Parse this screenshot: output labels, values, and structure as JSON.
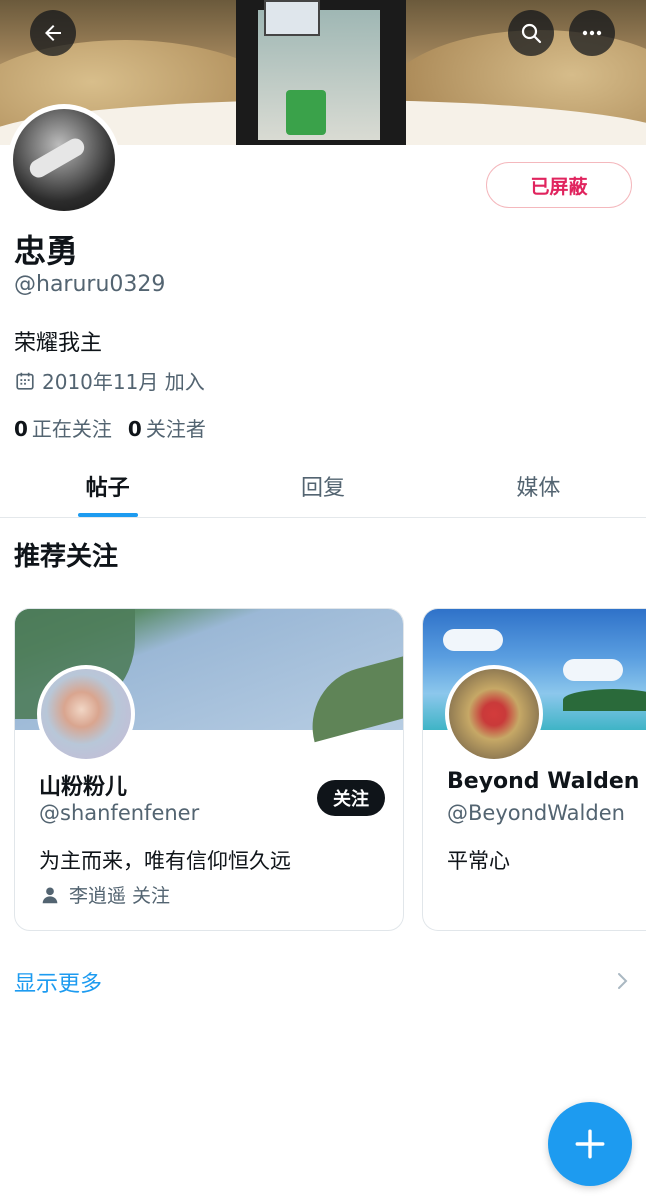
{
  "header": {
    "back_icon": "arrow-left-icon",
    "search_icon": "search-icon",
    "more_icon": "more-horizontal-icon"
  },
  "profile": {
    "display_name": "忠勇",
    "handle": "@haruru0329",
    "bio": "荣耀我主",
    "joined": "2010年11月 加入",
    "following_count": "0",
    "following_label": "正在关注",
    "followers_count": "0",
    "followers_label": "关注者",
    "blocked_label": "已屏蔽"
  },
  "tabs": [
    {
      "label": "帖子",
      "active": true
    },
    {
      "label": "回复",
      "active": false
    },
    {
      "label": "媒体",
      "active": false
    }
  ],
  "recommend": {
    "title": "推荐关注",
    "cards": [
      {
        "name": "山粉粉儿",
        "handle": "@shanfenfener",
        "bio": "为主而来，唯有信仰恒久远",
        "followed_by": "李逍遥 关注",
        "follow_label": "关注"
      },
      {
        "name": "Beyond Walden",
        "handle": "@BeyondWalden",
        "bio": "平常心"
      }
    ],
    "show_more": "显示更多"
  },
  "colors": {
    "accent": "#1d9bf0",
    "blocked_red": "#e0245e",
    "text_primary": "#0f1419",
    "text_secondary": "#536471"
  }
}
